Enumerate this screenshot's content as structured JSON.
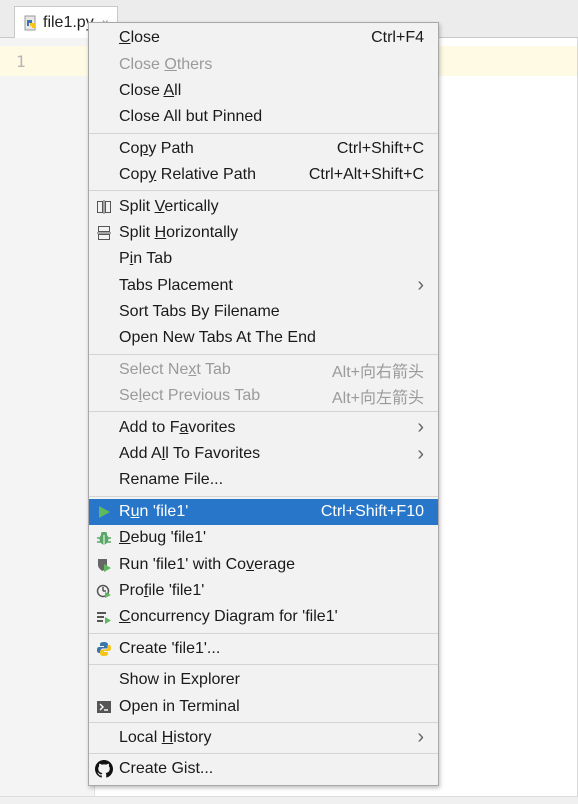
{
  "tab": {
    "filename": "file1.py",
    "close_glyph": "×"
  },
  "editor": {
    "line_number": "1"
  },
  "colors": {
    "selection": "#2776c9",
    "run_green": "#4aa84a",
    "debug_green": "#59a869",
    "python_blue": "#3a75b0",
    "python_yellow": "#f5c518"
  },
  "menu": {
    "groups": [
      [
        {
          "pre": "",
          "u": "C",
          "post": "lose",
          "shortcut": "Ctrl+F4",
          "disabled": false
        },
        {
          "pre": "Close ",
          "u": "O",
          "post": "thers",
          "shortcut": "",
          "disabled": true
        },
        {
          "pre": "Close ",
          "u": "A",
          "post": "ll",
          "shortcut": "",
          "disabled": false
        },
        {
          "pre": "Close All but Pinned",
          "u": "",
          "post": "",
          "shortcut": "",
          "disabled": false
        }
      ],
      [
        {
          "pre": "Co",
          "u": "p",
          "post": "y Path",
          "shortcut": "Ctrl+Shift+C",
          "disabled": false
        },
        {
          "pre": "Cop",
          "u": "y",
          "post": " Relative Path",
          "shortcut": "Ctrl+Alt+Shift+C",
          "disabled": false
        }
      ],
      [
        {
          "pre": "Split ",
          "u": "V",
          "post": "ertically",
          "shortcut": "",
          "icon": "split-vertical-icon",
          "disabled": false
        },
        {
          "pre": "Split ",
          "u": "H",
          "post": "orizontally",
          "shortcut": "",
          "icon": "split-horizontal-icon",
          "disabled": false
        },
        {
          "pre": "P",
          "u": "i",
          "post": "n Tab",
          "shortcut": "",
          "disabled": false
        },
        {
          "pre": "Tabs Placement",
          "u": "",
          "post": "",
          "shortcut": "",
          "submenu": true,
          "disabled": false
        },
        {
          "pre": "Sort Tabs By Filename",
          "u": "",
          "post": "",
          "shortcut": "",
          "disabled": false
        },
        {
          "pre": "Open New Tabs At The End",
          "u": "",
          "post": "",
          "shortcut": "",
          "disabled": false
        }
      ],
      [
        {
          "pre": "Select Ne",
          "u": "x",
          "post": "t Tab",
          "shortcut": "Alt+向右箭头",
          "disabled": true
        },
        {
          "pre": "Se",
          "u": "l",
          "post": "ect Previous Tab",
          "shortcut": "Alt+向左箭头",
          "disabled": true
        }
      ],
      [
        {
          "pre": "Add to F",
          "u": "a",
          "post": "vorites",
          "shortcut": "",
          "submenu": true,
          "disabled": false
        },
        {
          "pre": "Add A",
          "u": "l",
          "post": "l To Favorites",
          "shortcut": "",
          "submenu": true,
          "disabled": false
        },
        {
          "pre": "Rename File...",
          "u": "",
          "post": "",
          "shortcut": "",
          "disabled": false
        }
      ],
      [
        {
          "pre": "R",
          "u": "u",
          "post": "n 'file1'",
          "shortcut": "Ctrl+Shift+F10",
          "icon": "run-icon",
          "selected": true,
          "disabled": false
        },
        {
          "pre": "",
          "u": "D",
          "post": "ebug 'file1'",
          "shortcut": "",
          "icon": "debug-icon",
          "disabled": false
        },
        {
          "pre": "Run 'file1' with Co",
          "u": "v",
          "post": "erage",
          "shortcut": "",
          "icon": "coverage-icon",
          "disabled": false
        },
        {
          "pre": "Pro",
          "u": "f",
          "post": "ile 'file1'",
          "shortcut": "",
          "icon": "profile-icon",
          "disabled": false
        },
        {
          "pre": "",
          "u": "C",
          "post": "oncurrency Diagram for 'file1'",
          "shortcut": "",
          "icon": "concurrency-icon",
          "disabled": false
        }
      ],
      [
        {
          "pre": "Create 'file1'...",
          "u": "",
          "post": "",
          "shortcut": "",
          "icon": "python-icon",
          "disabled": false
        }
      ],
      [
        {
          "pre": "Show in Explorer",
          "u": "",
          "post": "",
          "shortcut": "",
          "disabled": false
        },
        {
          "pre": "Open in Terminal",
          "u": "",
          "post": "",
          "shortcut": "",
          "icon": "terminal-icon",
          "disabled": false
        }
      ],
      [
        {
          "pre": "Local ",
          "u": "H",
          "post": "istory",
          "shortcut": "",
          "submenu": true,
          "disabled": false
        }
      ],
      [
        {
          "pre": "Create Gist...",
          "u": "",
          "post": "",
          "shortcut": "",
          "icon": "github-icon",
          "disabled": false
        }
      ]
    ]
  }
}
